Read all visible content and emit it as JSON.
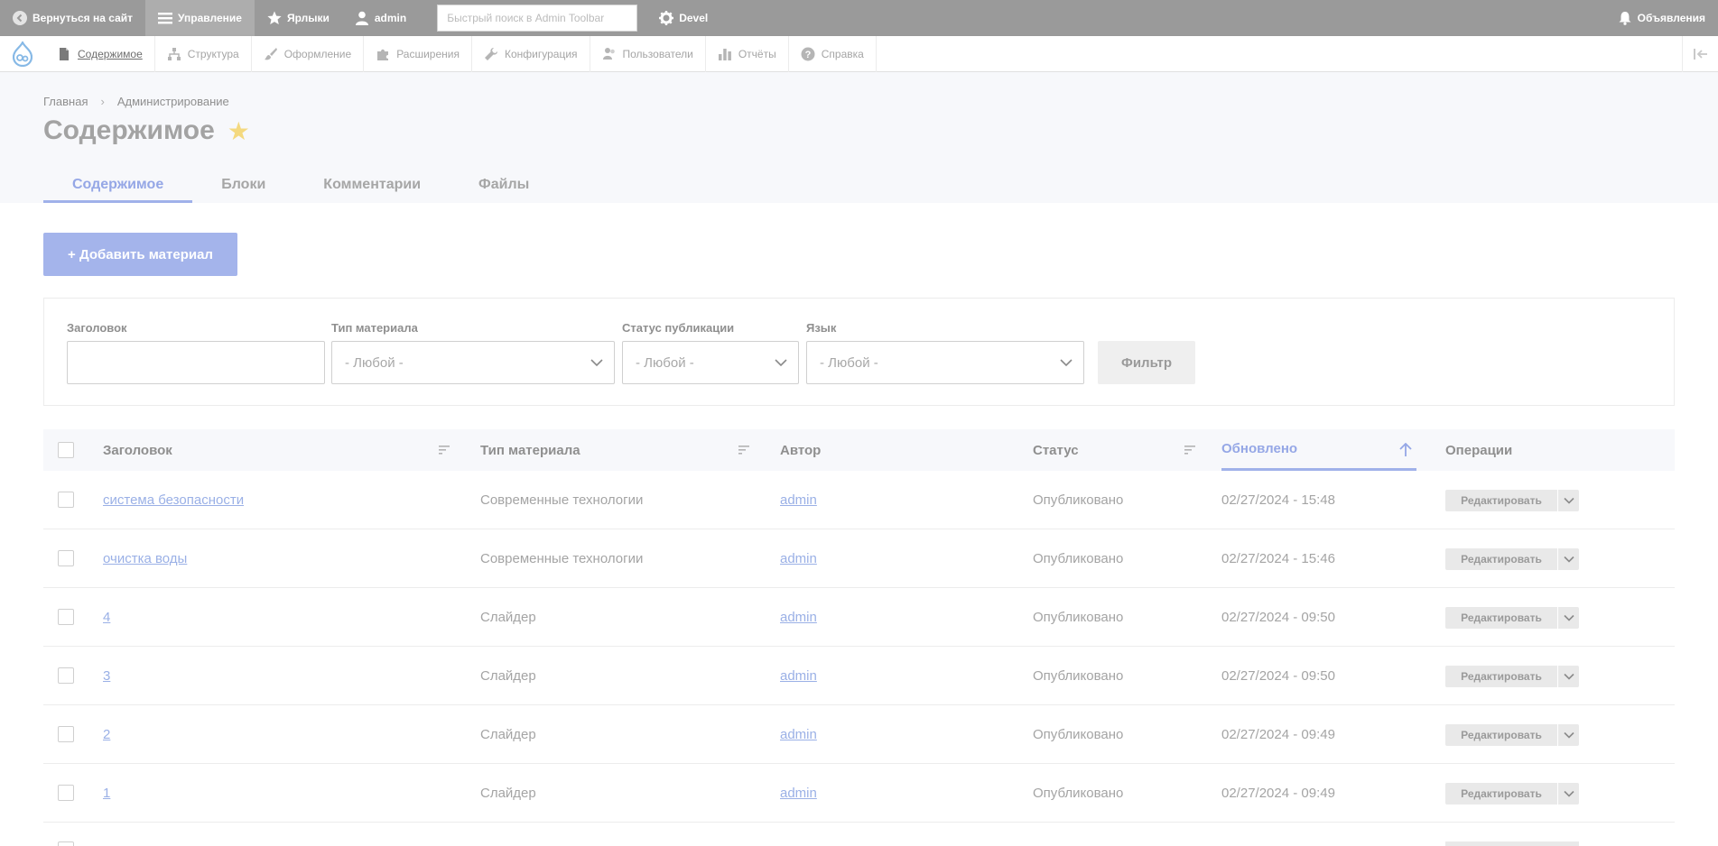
{
  "toolbar": {
    "back": "Вернуться на сайт",
    "manage": "Управление",
    "shortcuts": "Ярлыки",
    "user": "admin",
    "search_placeholder": "Быстрый поиск в Admin Toolbar",
    "devel": "Devel",
    "announcements": "Объявления"
  },
  "tray": {
    "items": [
      "Содержимое",
      "Структура",
      "Оформление",
      "Расширения",
      "Конфигурация",
      "Пользователи",
      "Отчёты",
      "Справка"
    ]
  },
  "breadcrumb": [
    "Главная",
    "Администрирование"
  ],
  "page_title": "Содержимое",
  "tabs": [
    "Содержимое",
    "Блоки",
    "Комментарии",
    "Файлы"
  ],
  "add_button": "+ Добавить материал",
  "filters": {
    "title_label": "Заголовок",
    "type_label": "Тип материала",
    "type_value": "- Любой -",
    "status_label": "Статус публикации",
    "status_value": "- Любой -",
    "lang_label": "Язык",
    "lang_value": "- Любой -",
    "submit": "Фильтр"
  },
  "table": {
    "headers": {
      "title": "Заголовок",
      "type": "Тип материала",
      "author": "Автор",
      "status": "Статус",
      "updated": "Обновлено",
      "operations": "Операции"
    },
    "edit_label": "Редактировать",
    "rows": [
      {
        "title": "система безопасности",
        "type": "Современные технологии",
        "author": "admin",
        "status": "Опубликовано",
        "updated": "02/27/2024 - 15:48"
      },
      {
        "title": "очистка воды",
        "type": "Современные технологии",
        "author": "admin",
        "status": "Опубликовано",
        "updated": "02/27/2024 - 15:46"
      },
      {
        "title": "4",
        "type": "Слайдер",
        "author": "admin",
        "status": "Опубликовано",
        "updated": "02/27/2024 - 09:50"
      },
      {
        "title": "3",
        "type": "Слайдер",
        "author": "admin",
        "status": "Опубликовано",
        "updated": "02/27/2024 - 09:50"
      },
      {
        "title": "2",
        "type": "Слайдер",
        "author": "admin",
        "status": "Опубликовано",
        "updated": "02/27/2024 - 09:49"
      },
      {
        "title": "1",
        "type": "Слайдер",
        "author": "admin",
        "status": "Опубликовано",
        "updated": "02/27/2024 - 09:49"
      }
    ]
  }
}
